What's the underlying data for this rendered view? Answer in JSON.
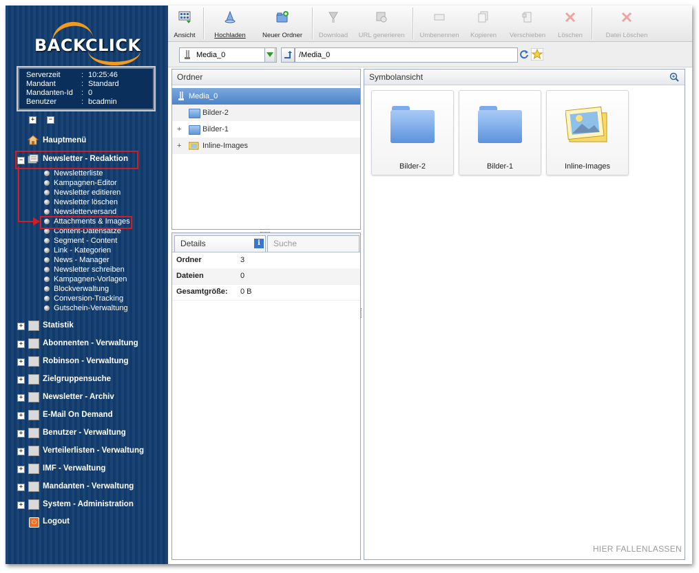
{
  "sidebar": {
    "logo_text": "BACKCLICK",
    "info": [
      {
        "key": "Serverzeit",
        "value": "10:25:46"
      },
      {
        "key": "Mandant",
        "value": "Standard"
      },
      {
        "key": "Mandanten-Id",
        "value": "0"
      },
      {
        "key": "Benutzer",
        "value": "bcadmin"
      }
    ],
    "expand_all": "+",
    "collapse_all": "−",
    "home": "Hauptmenü",
    "newsletter_section": "Newsletter - Redaktion",
    "newsletter_items": [
      "Newsletterliste",
      "Kampagnen-Editor",
      "Newsletter editieren",
      "Newsletter löschen",
      "Newsletterversand",
      "Attachments & Images",
      "Content-Datensätze",
      "Segment - Content",
      "Link - Kategorien",
      "News - Manager",
      "Newsletter schreiben",
      "Kampagnen-Vorlagen",
      "Blockverwaltung",
      "Conversion-Tracking",
      "Gutschein-Verwaltung"
    ],
    "sections": [
      "Statistik",
      "Abonnenten - Verwaltung",
      "Robinson - Verwaltung",
      "Zielgruppensuche",
      "Newsletter - Archiv",
      "E-Mail On Demand",
      "Benutzer - Verwaltung",
      "Verteilerlisten - Verwaltung",
      "IMF - Verwaltung",
      "Mandanten - Verwaltung",
      "System - Administration"
    ],
    "logout": "Logout"
  },
  "toolbar": {
    "view": "Ansicht",
    "upload": "Hochladen",
    "new_folder": "Neuer Ordner",
    "download": "Download",
    "url": "URL generieren",
    "rename": "Umbenennen",
    "copy": "Kopieren",
    "move": "Verschieben",
    "delete": "Löschen",
    "delete_file": "Datei Löschen"
  },
  "address": {
    "drive": "Media_0",
    "path": "/Media_0"
  },
  "folders_panel": {
    "title": "Ordner",
    "root": "Media_0",
    "items": [
      "Bilder-2",
      "Bilder-1",
      "Inline-Images"
    ]
  },
  "details_panel": {
    "tab_details": "Details",
    "tab_search": "Suche",
    "rows": [
      {
        "key": "Ordner",
        "value": "3"
      },
      {
        "key": "Dateien",
        "value": "0"
      },
      {
        "key": "Gesamtgröße:",
        "value": "0 B"
      }
    ]
  },
  "symbol_panel": {
    "title": "Symbolansicht",
    "tiles": [
      "Bilder-2",
      "Bilder-1",
      "Inline-Images"
    ],
    "drop_hint": "HIER FALLENLASSEN"
  },
  "colors": {
    "sidebar_bg": "#0f3a6b",
    "highlight_red": "#d21d24",
    "selection_blue": "#4c84c8",
    "logo_orange": "#f39a1b"
  }
}
